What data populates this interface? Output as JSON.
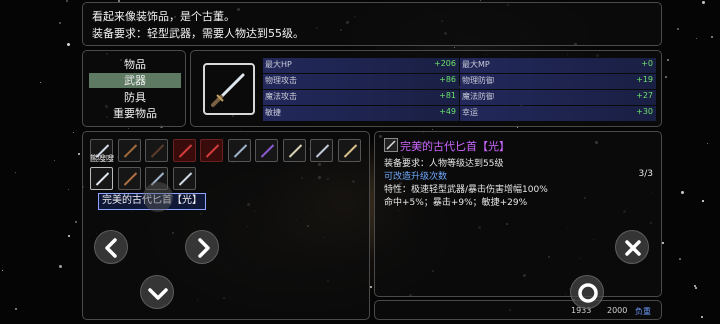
{
  "description": {
    "line1": "看起来像装饰品，是个古董。",
    "line2": "装备要求：轻型武器，需要人物达到55级。"
  },
  "categories": [
    {
      "label": "物品",
      "selected": false
    },
    {
      "label": "武器",
      "selected": true
    },
    {
      "label": "防具",
      "selected": false
    },
    {
      "label": "重要物品",
      "selected": false
    }
  ],
  "stats": [
    {
      "left_label": "最大HP",
      "left_value": "+206",
      "right_label": "最大MP",
      "right_value": "+0"
    },
    {
      "left_label": "物理攻击",
      "left_value": "+86",
      "right_label": "物理防御",
      "right_value": "+19"
    },
    {
      "left_label": "魔法攻击",
      "left_value": "+81",
      "right_label": "魔法防御",
      "right_value": "+27"
    },
    {
      "left_label": "敏捷",
      "left_value": "+49",
      "right_label": "幸运",
      "right_value": "+30"
    }
  ],
  "inventory": {
    "first_slot_label": "熊嗖嗖",
    "tooltip": "完美的古代匕首【光】",
    "row1_colors": [
      "#cfd8e4",
      "#a06a3c",
      "#5a3c28",
      "#d23c3c",
      "#d23c3c",
      "#9fb4c8",
      "#8a5ad0",
      "#d8d2b4",
      "#c0c8d8",
      "#d8c08a"
    ],
    "row2_colors": [
      "#dfe6ee",
      "#b07040",
      "#9fb4c8",
      "#cfd8e4"
    ]
  },
  "detail": {
    "name": "完美的古代匕首【光】",
    "requirement": "装备要求：人物等级达到55级",
    "upgrade": "可改造升级次数",
    "upgrade_count": "3/3",
    "trait": "特性：极速轻型武器/暴击伤害增幅100%",
    "bonus": "命中+5%；暴击+9%；敏捷+29%",
    "name_color": "#cc66ff",
    "upgrade_color": "#6fa8ff"
  },
  "footer": {
    "gold": "1933",
    "capacity": "2000",
    "weight_label": "负重"
  },
  "icons": {
    "left": "chevron-left-icon",
    "right": "chevron-right-icon",
    "down": "chevron-down-icon",
    "close": "close-icon",
    "confirm": "ring-icon"
  }
}
